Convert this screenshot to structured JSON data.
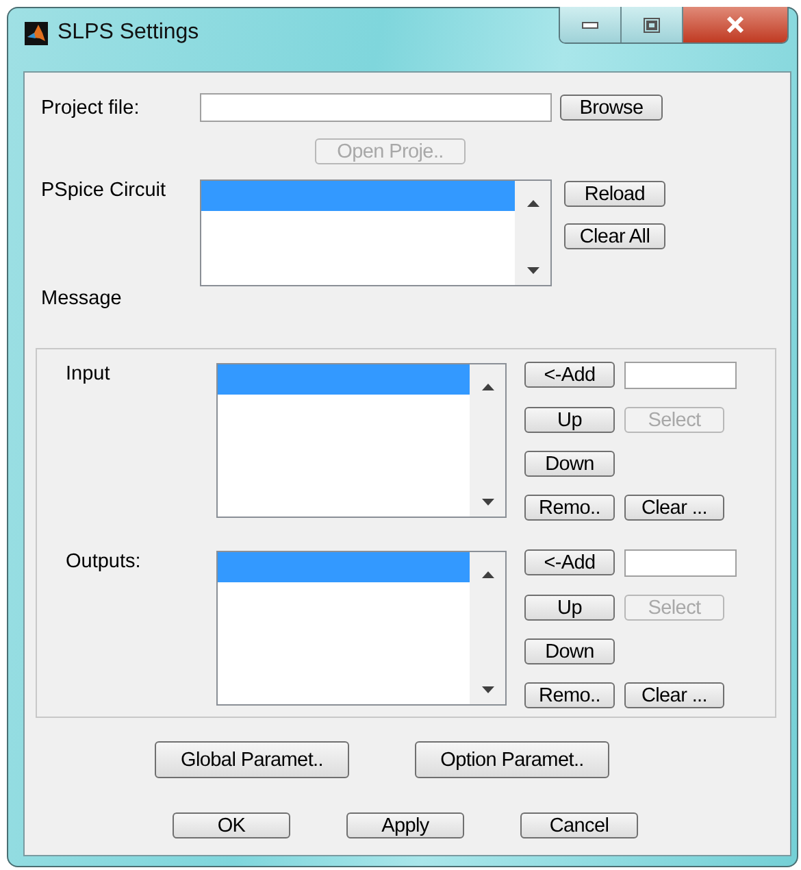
{
  "window": {
    "title": "SLPS Settings"
  },
  "project_file": {
    "label": "Project file:",
    "browse_button": {
      "label": "Browse",
      "disabled": false
    },
    "open_button": {
      "label": "Open Proje..",
      "disabled": true
    }
  },
  "circuit_file": {
    "label": "PSpice Circuit",
    "rows": [
      {
        "selected": true
      }
    ],
    "buttons": [
      {
        "label": "Reload",
        "disabled": false
      },
      {
        "label": "Clear All",
        "disabled": false
      }
    ]
  },
  "message_label": "Message",
  "lists": [
    {
      "label": "Input",
      "rows": [
        {
          "selected": true
        }
      ],
      "add_button": {
        "label": "<-Add",
        "disabled": false
      },
      "up_button": {
        "label": "Up",
        "disabled": false
      },
      "select_button": {
        "label": "Select",
        "disabled": true
      },
      "down_button": {
        "label": "Down",
        "disabled": false
      },
      "remove_button": {
        "label": "Remo..",
        "disabled": false
      },
      "clear_button": {
        "label": "Clear ...",
        "disabled": false
      }
    },
    {
      "label": "Outputs:",
      "rows": [
        {
          "selected": true
        }
      ],
      "add_button": {
        "label": "<-Add",
        "disabled": false
      },
      "up_button": {
        "label": "Up",
        "disabled": false
      },
      "select_button": {
        "label": "Select",
        "disabled": true
      },
      "down_button": {
        "label": "Down",
        "disabled": false
      },
      "remove_button": {
        "label": "Remo..",
        "disabled": false
      },
      "clear_button": {
        "label": "Clear ...",
        "disabled": false
      }
    }
  ],
  "parameter_buttons": [
    {
      "label": "Global Paramet..",
      "disabled": false
    },
    {
      "label": "Option Paramet..",
      "disabled": false
    }
  ],
  "dialog_buttons": [
    {
      "label": "OK",
      "disabled": false
    },
    {
      "label": "Apply",
      "disabled": false
    },
    {
      "label": "Cancel",
      "disabled": false
    }
  ]
}
